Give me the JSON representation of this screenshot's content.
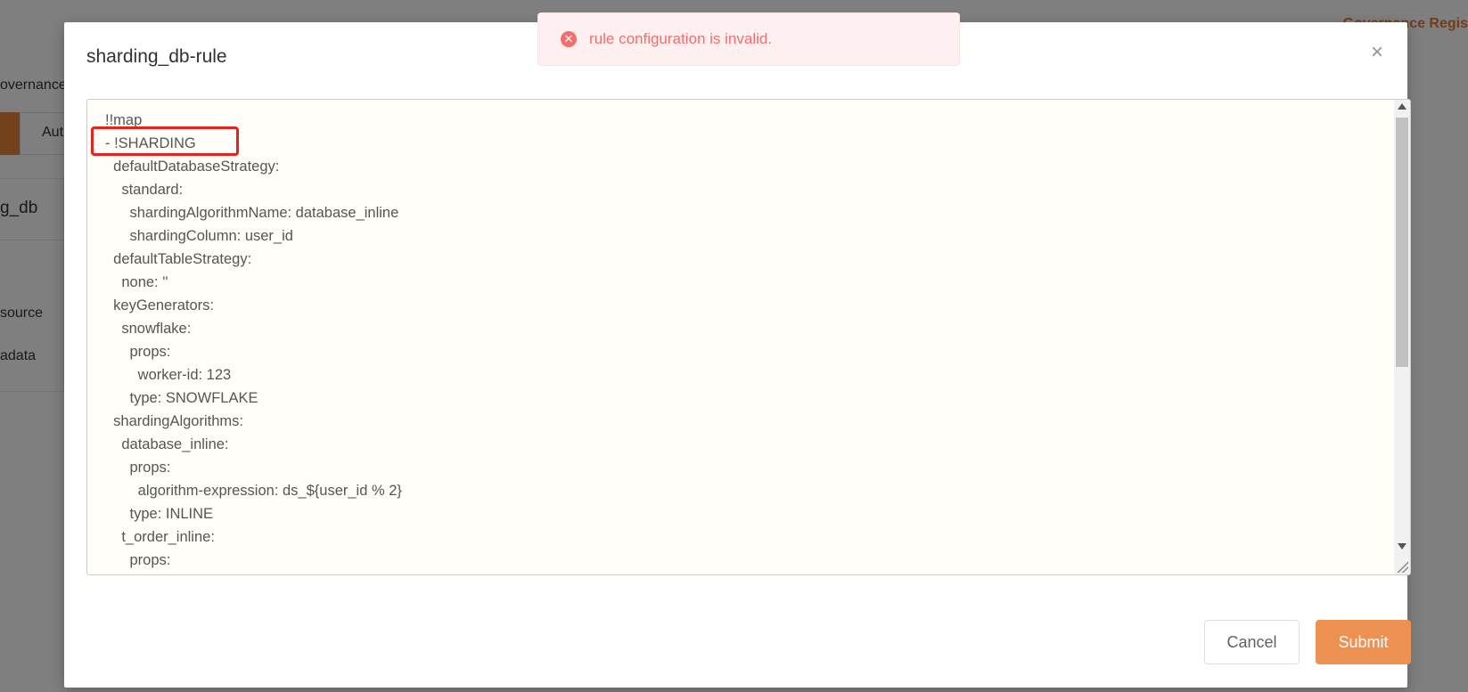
{
  "background": {
    "top_right_text": "Governance Regis",
    "governance_label": "overnance",
    "tab_label": "Aut",
    "card_title": "g_db",
    "card_item_1": "source",
    "card_item_2": "adata"
  },
  "modal": {
    "title": "sharding_db-rule",
    "close_icon": "×",
    "editor_lines": [
      "!!map",
      "- !SHARDING",
      "  defaultDatabaseStrategy:",
      "    standard:",
      "      shardingAlgorithmName: database_inline",
      "      shardingColumn: user_id",
      "  defaultTableStrategy:",
      "    none: ''",
      "  keyGenerators:",
      "    snowflake:",
      "      props:",
      "        worker-id: 123",
      "      type: SNOWFLAKE",
      "  shardingAlgorithms:",
      "    database_inline:",
      "      props:",
      "        algorithm-expression: ds_${user_id % 2}",
      "      type: INLINE",
      "    t_order_inline:",
      "      props:"
    ],
    "cancel_label": "Cancel",
    "submit_label": "Submit"
  },
  "toast": {
    "icon": "✕",
    "message": "rule configuration is invalid."
  },
  "colors": {
    "accent": "#ec9152",
    "error": "#f56c6c",
    "highlight": "#e8201e"
  }
}
